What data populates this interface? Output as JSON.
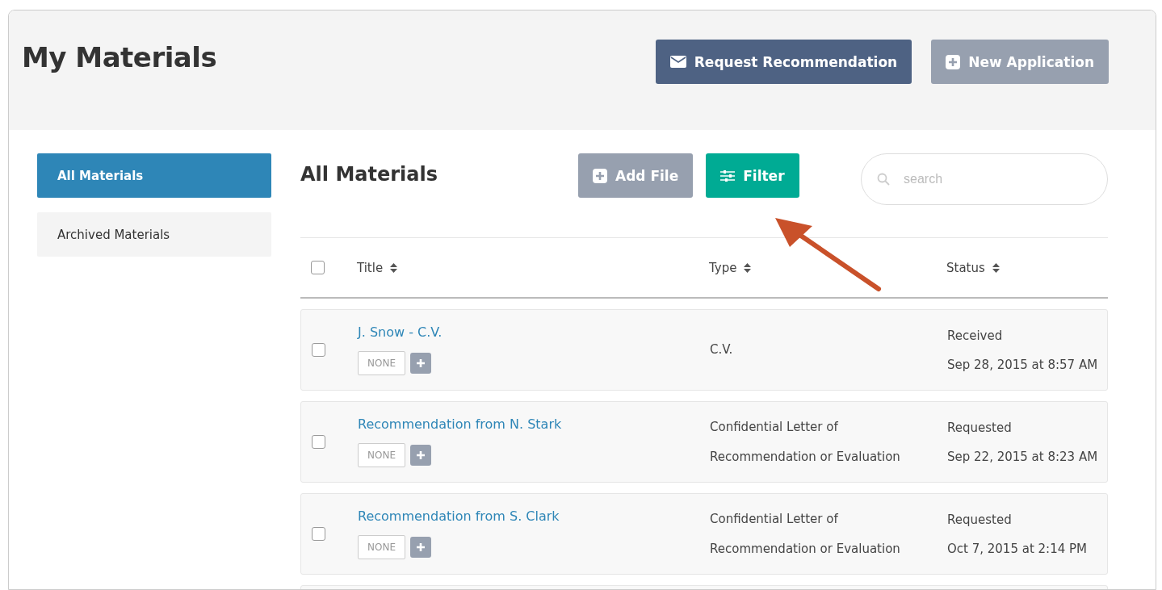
{
  "page_title": "My Materials",
  "header_buttons": [
    {
      "label": "Request Recommendation",
      "kind": "mail",
      "disabled": false
    },
    {
      "label": "New Application",
      "kind": "plus",
      "disabled": true
    }
  ],
  "sidebar": {
    "items": [
      {
        "label": "All Materials",
        "selected": true
      },
      {
        "label": "Archived Materials",
        "selected": false
      }
    ]
  },
  "section_title": "All Materials",
  "toolbar_buttons": [
    {
      "label": "Add File",
      "kind": "plus"
    },
    {
      "label": "Filter",
      "kind": "filter"
    }
  ],
  "search": {
    "placeholder": "search"
  },
  "table": {
    "select_all_checked": false,
    "columns": [
      {
        "label": "Title"
      },
      {
        "label": "Type"
      },
      {
        "label": "Status"
      }
    ],
    "rows": [
      {
        "checked": false,
        "title": "J. Snow - C.V.",
        "tag": "NONE",
        "type": "C.V.",
        "status": "Received",
        "date": "Sep 28, 2015 at 8:57 AM"
      },
      {
        "checked": false,
        "title": "Recommendation from N. Stark",
        "tag": "NONE",
        "type": "Confidential Letter of Recommendation or Evaluation",
        "status": "Requested",
        "date": "Sep 22, 2015 at 8:23 AM"
      },
      {
        "checked": false,
        "title": "Recommendation from S. Clark",
        "tag": "NONE",
        "type": "Confidential Letter of Recommendation or Evaluation",
        "status": "Requested",
        "date": "Oct 7, 2015 at 2:14 PM"
      }
    ]
  }
}
